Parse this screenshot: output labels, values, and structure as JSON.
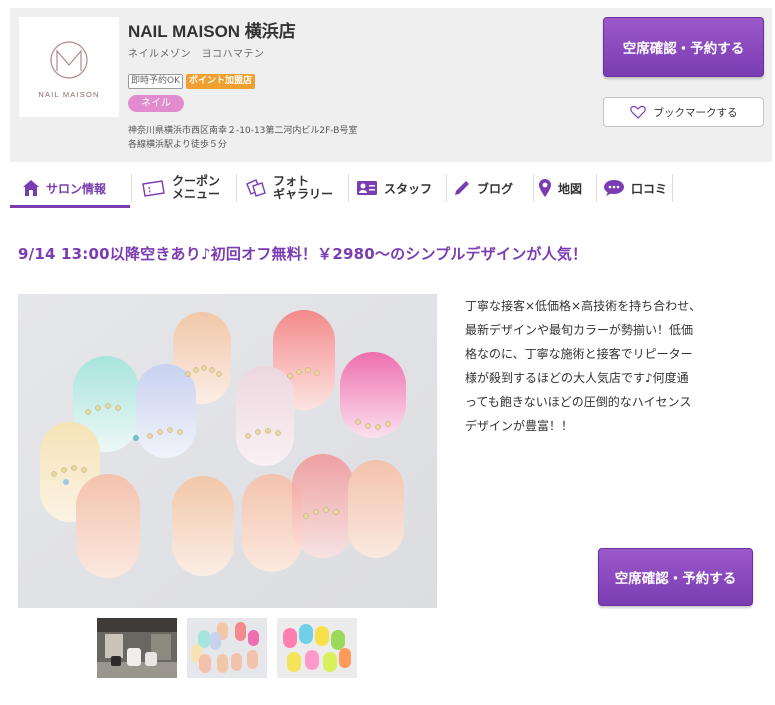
{
  "salon": {
    "logo_text": "NAIL MAISON",
    "name": "NAIL MAISON 横浜店",
    "kana": "ネイルメゾン　ヨコハマテン",
    "badges": [
      "即時予約OK",
      "ポイント加盟店"
    ],
    "genre": "ネイル",
    "address_line1": "神奈川県横浜市西区南幸２-10-13第二河内ビル2F-B号室",
    "address_line2": "各線横浜駅より徒歩５分"
  },
  "buttons": {
    "reserve_label": "空席確認・予約する",
    "bookmark_label": "ブックマークする",
    "reserve2_label": "空席確認・予約する"
  },
  "nav": {
    "items": [
      {
        "label": "サロン情報",
        "icon": "home-icon"
      },
      {
        "label_line1": "クーポン",
        "label_line2": "メニュー",
        "icon": "coupon-icon"
      },
      {
        "label_line1": "フォト",
        "label_line2": "ギャラリー",
        "icon": "photo-icon"
      },
      {
        "label": "スタッフ",
        "icon": "staff-card-icon"
      },
      {
        "label": "ブログ",
        "icon": "pen-icon"
      },
      {
        "label": "地図",
        "icon": "map-pin-icon"
      },
      {
        "label": "口コミ",
        "icon": "speech-bubble-icon"
      }
    ]
  },
  "main": {
    "headline": "9/14 13:00以降空きあり♪初回オフ無料！￥2980～のシンプルデザインが人気！",
    "description_lines": [
      "丁寧な接客×低価格×高技術を持ち合わせ、",
      "最新デザインや最旬カラーが勢揃い！低価",
      "格なのに、丁寧な施術と接客でリピーター",
      "様が殺到するほどの大人気店です♪何度通",
      "っても飽きないほどの圧倒的なハイセンス",
      "デザインが豊富！！"
    ]
  },
  "colors": {
    "accent_purple": "#7a3cb3",
    "header_bg": "#f0efef",
    "genre_pink": "#e08ccf",
    "badge_orange": "#f0a030"
  }
}
